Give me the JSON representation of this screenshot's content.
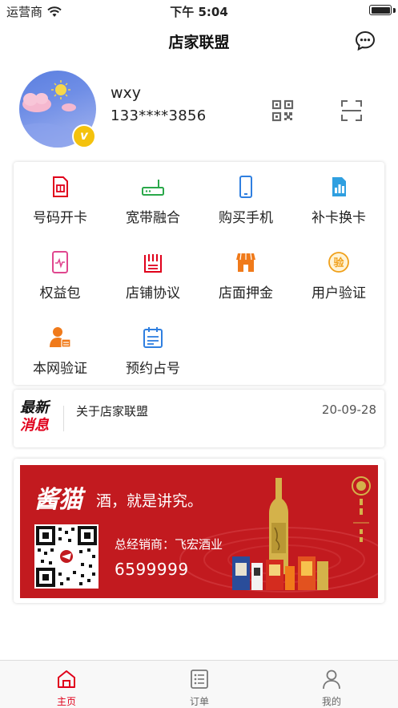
{
  "status_bar": {
    "carrier": "运营商",
    "time": "下午 5:04"
  },
  "nav": {
    "title": "店家联盟",
    "message_icon": "chat-bubble-icon"
  },
  "profile": {
    "name": "wxy",
    "phone": "133****3856",
    "badge": "v",
    "qr_icon": "qr-code-icon",
    "scan_icon": "scan-icon"
  },
  "services": [
    {
      "label": "号码开卡",
      "icon": "sim-card-icon",
      "color": "#e0001b"
    },
    {
      "label": "宽带融合",
      "icon": "router-icon",
      "color": "#2aa84a"
    },
    {
      "label": "购买手机",
      "icon": "phone-icon",
      "color": "#2f7fe0"
    },
    {
      "label": "补卡换卡",
      "icon": "sim-swap-icon",
      "color": "#2f9fe0"
    },
    {
      "label": "权益包",
      "icon": "benefit-package-icon",
      "color": "#e0478f"
    },
    {
      "label": "店铺协议",
      "icon": "agreement-icon",
      "color": "#e0001b"
    },
    {
      "label": "店面押金",
      "icon": "shop-deposit-icon",
      "color": "#f07a1a"
    },
    {
      "label": "用户验证",
      "icon": "verify-icon",
      "color": "#f0a01a"
    },
    {
      "label": "本网验证",
      "icon": "network-verify-icon",
      "color": "#f07a1a"
    },
    {
      "label": "预约占号",
      "icon": "reserve-number-icon",
      "color": "#2f7fe0"
    }
  ],
  "news": {
    "logo_line1": "最新",
    "logo_line2": "消息",
    "title": "关于店家联盟",
    "date": "20-09-28"
  },
  "banner": {
    "brand": "酱猫",
    "slogan": "酒，就是讲究。",
    "distributor": "总经销商：飞宏酒业",
    "phone": "6599999",
    "colors": {
      "background": "#c21a1f",
      "gold": "#d4b24a"
    }
  },
  "tabs": [
    {
      "label": "主页",
      "icon": "home-icon",
      "active": true
    },
    {
      "label": "订单",
      "icon": "order-list-icon",
      "active": false
    },
    {
      "label": "我的",
      "icon": "user-icon",
      "active": false
    }
  ],
  "colors": {
    "accent": "#e0001b",
    "text": "#222222"
  }
}
